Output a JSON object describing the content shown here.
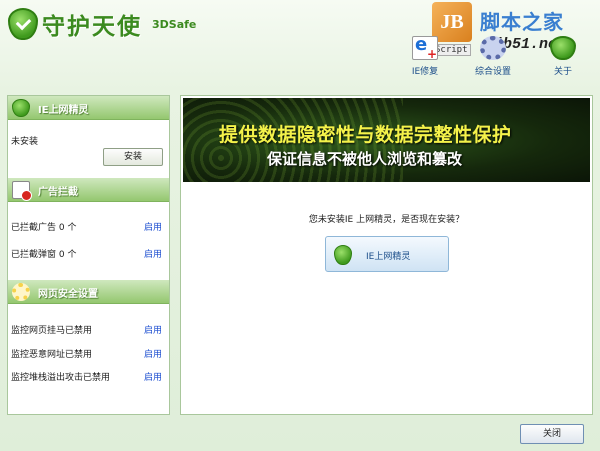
{
  "app": {
    "title": "守护天使",
    "subtitle": "3DSafe"
  },
  "watermark": {
    "logo_text": "JB",
    "site_name": "脚本之家",
    "url": "jb51.net",
    "script_tag": "Script"
  },
  "toolbar": {
    "items": [
      {
        "label": "IE修复",
        "icon": "ie-repair-icon"
      },
      {
        "label": "综合设置",
        "icon": "gear-icon"
      },
      {
        "label": "关于",
        "icon": "shield-icon"
      }
    ]
  },
  "sidebar": {
    "ie_sprite": {
      "title": "IE上网精灵",
      "status": "未安装",
      "install_label": "安装"
    },
    "ad_block": {
      "title": "广告拦截",
      "rows": [
        {
          "label": "已拦截广告 0 个",
          "action": "启用"
        },
        {
          "label": "已拦截弹窗 0 个",
          "action": "启用"
        }
      ]
    },
    "web_security": {
      "title": "网页安全设置",
      "rows": [
        {
          "label": "监控网页挂马已禁用",
          "action": "启用"
        },
        {
          "label": "监控恶意网址已禁用",
          "action": "启用"
        },
        {
          "label": "监控堆栈溢出攻击已禁用",
          "action": "启用"
        }
      ]
    }
  },
  "main": {
    "banner_line1": "提供数据隐密性与数据完整性保护",
    "banner_line2": "保证信息不被他人浏览和篡改",
    "prompt": "您未安装IE 上网精灵，是否现在安装？",
    "ie_button_label": "IE上网精灵"
  },
  "footer": {
    "close_label": "关闭"
  },
  "colors": {
    "accent_green": "#3b8a1f",
    "link_blue": "#1c4ed0",
    "banner_yellow": "#f4f24a"
  }
}
